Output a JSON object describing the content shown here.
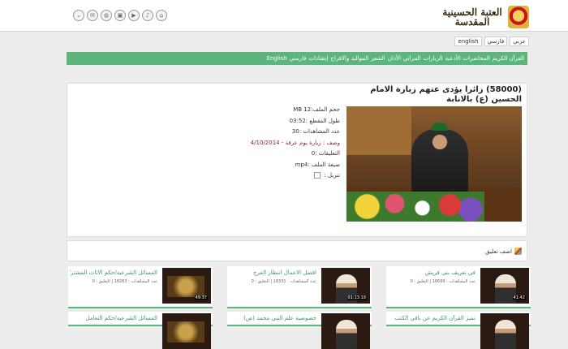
{
  "site": {
    "logo_text": "العتبة الحسينية المقدسة"
  },
  "languages": [
    "عربي",
    "فارسي",
    "english"
  ],
  "nav_items": [
    "القرآن الكريم",
    "المحاضرات",
    "الأدعية",
    "الزيارات",
    "المراثي",
    "الأذان",
    "الشعر",
    "المواليد والافراح",
    "إنشادات",
    "فارسي",
    "English"
  ],
  "video": {
    "title": "(58000) زائرا يؤدى عتهم زيارة الامام الحسين (ع) بالانابة",
    "file_size": "حجم الملف:12 MB",
    "duration": "طول المقطع :03:52",
    "views": "عدد المشاهدات :30",
    "description": "وصف : زيارة يوم عرفة - 4/10/2014",
    "comments": "التعليقات :0",
    "format": "صيغة الملف :mp4",
    "download": "تنزيل :"
  },
  "comment": {
    "add_label": "اضف تعليق"
  },
  "cards": [
    {
      "title": "في تعريف بني قريش",
      "meta": "عدد المشاهدات : 18699 | التعليق : 0",
      "duration": "41:42"
    },
    {
      "title": "افضل الاعمال انتظار الفرج",
      "meta": "عدد المشاهدات : 18331 | التعليق : 0",
      "duration": "01:13:19"
    },
    {
      "title": "المسائل الشرعية/حكم الاثاث المشتركة",
      "meta": "عدد المشاهدات : 18263 | التعليق : 0",
      "duration": "49:37"
    },
    {
      "title": "تميز القرآن الكريم عن باقي الكتب",
      "meta": "",
      "duration": ""
    },
    {
      "title": "خصوصية علم النبي محمد (ص)",
      "meta": "",
      "duration": ""
    },
    {
      "title": "المسائل الشرعية/حكم التعامل",
      "meta": "",
      "duration": ""
    }
  ]
}
